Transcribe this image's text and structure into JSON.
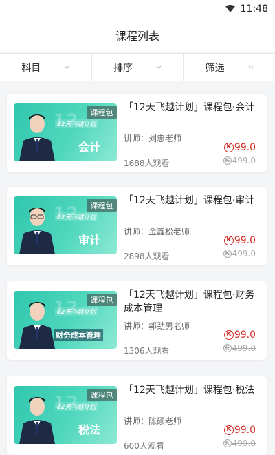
{
  "status": {
    "time": "11:48"
  },
  "header": {
    "title": "课程列表"
  },
  "filters": [
    {
      "label": "科目"
    },
    {
      "label": "排序"
    },
    {
      "label": "筛选"
    }
  ],
  "courses": [
    {
      "title": "「12天飞越计划」课程包·会计",
      "badge": "课程包",
      "plan_text": "12天飞越计划",
      "subject": "会计",
      "teacher": "讲师：刘忠老师",
      "views": "1688人观看",
      "price": "99.0",
      "original_price": "499.0"
    },
    {
      "title": "「12天飞越计划」课程包·审计",
      "badge": "课程包",
      "plan_text": "12天飞越计划",
      "subject": "审计",
      "teacher": "讲师：金鑫松老师",
      "views": "2898人观看",
      "price": "99.0",
      "original_price": "499.0"
    },
    {
      "title": "「12天飞越计划」课程包·财务成本管理",
      "badge": "课程包",
      "plan_text": "12天飞越计划",
      "subject": "财务成本管理",
      "teacher": "讲师：郭劲男老师",
      "views": "1306人观看",
      "price": "99.0",
      "original_price": "499.0"
    },
    {
      "title": "「12天飞越计划」课程包·税法",
      "badge": "课程包",
      "plan_text": "12天飞越计划",
      "subject": "税法",
      "teacher": "讲师：陈硕老师",
      "views": "600人观看",
      "price": "99.0",
      "original_price": "499.0"
    }
  ],
  "colors": {
    "price": "#d42b24",
    "thumb": "#2fc7ae"
  }
}
